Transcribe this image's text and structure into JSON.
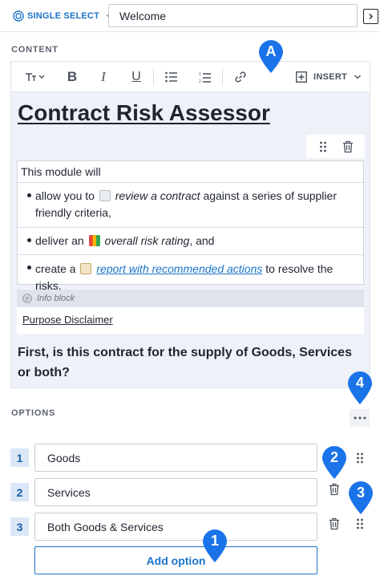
{
  "topbar": {
    "type_label": "SINGLE SELECT",
    "title_value": "Welcome"
  },
  "content_label": "CONTENT",
  "toolbar": {
    "insert_label": "INSERT"
  },
  "editor": {
    "title": "Contract Risk Assessor",
    "intro": "This module will",
    "bullets": [
      {
        "pre": "allow you to",
        "em": "review a contract",
        "post": "against a series of supplier friendly criteria,"
      },
      {
        "pre": "deliver an",
        "em": "overall risk rating",
        "post": ", and"
      },
      {
        "pre": "create a",
        "link": "report with recommended actions",
        "post": "to resolve the risks."
      }
    ],
    "info_block_label": "Info block",
    "info_block_text": "Purpose Disclaimer",
    "question": "First, is this contract for the supply of Goods, Services or both?"
  },
  "options_label": "OPTIONS",
  "options": [
    {
      "num": "1",
      "value": "Goods"
    },
    {
      "num": "2",
      "value": "Services"
    },
    {
      "num": "3",
      "value": "Both Goods & Services"
    }
  ],
  "add_option_label": "Add option",
  "annotations": [
    "A",
    "4",
    "2",
    "3",
    "1"
  ],
  "colors": {
    "accent": "#1a73c9",
    "pin": "#1a73e8",
    "editor_bg": "#eef2f8"
  }
}
